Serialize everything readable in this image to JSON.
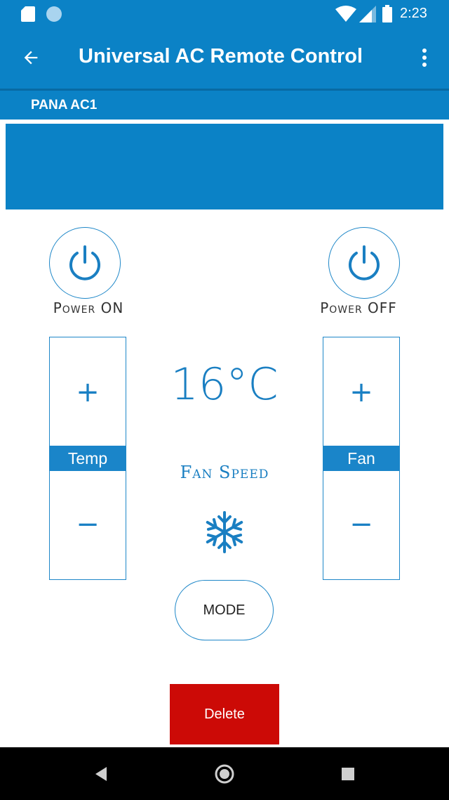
{
  "status_bar": {
    "time": "2:23",
    "icons": [
      "sd-card-icon",
      "notification-dot-icon",
      "wifi-icon",
      "signal-icon",
      "battery-icon"
    ]
  },
  "app_bar": {
    "title": "Universal AC Remote Control",
    "back_icon": "arrow-left-icon",
    "more_icon": "more-vert-icon"
  },
  "device": {
    "name": "PANA AC1"
  },
  "remote": {
    "power_on_label": "Power ON",
    "power_off_label": "Power OFF",
    "temp_label": "Temp",
    "fan_label": "Fan",
    "plus": "+",
    "minus": "−",
    "temperature": "16°C",
    "fan_speed_label": "Fan Speed",
    "mode_icon": "snowflake-icon",
    "mode_button": "MODE",
    "delete_button": "Delete"
  },
  "colors": {
    "primary": "#0b82c6",
    "accent_text": "#1a7fc2",
    "delete": "#cc0a06",
    "nav_bar": "#000000"
  }
}
